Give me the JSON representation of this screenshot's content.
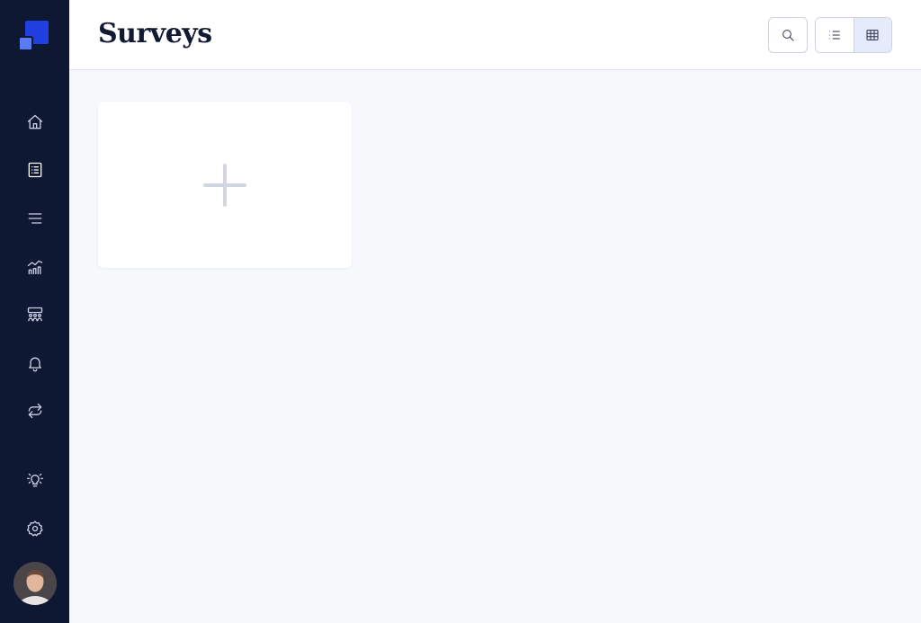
{
  "app": {
    "logo_icon": "brand-logo-icon"
  },
  "sidebar": {
    "items": [
      {
        "name": "home",
        "icon": "home-icon",
        "active": false
      },
      {
        "name": "surveys",
        "icon": "clipboard-list-icon",
        "active": true
      },
      {
        "name": "menu",
        "icon": "lines-icon",
        "active": false
      },
      {
        "name": "analytics",
        "icon": "chart-icon",
        "active": false
      },
      {
        "name": "audiences",
        "icon": "people-icon",
        "active": false
      },
      {
        "name": "notifications",
        "icon": "bell-icon",
        "active": false
      },
      {
        "name": "integrations",
        "icon": "repeat-icon",
        "active": false
      }
    ],
    "bottom_items": [
      {
        "name": "ideas",
        "icon": "lightbulb-icon"
      },
      {
        "name": "settings",
        "icon": "gear-icon"
      }
    ],
    "avatar_icon": "user-avatar"
  },
  "header": {
    "title": "Surveys",
    "search_icon": "search-icon",
    "view_modes": [
      {
        "name": "list",
        "icon": "list-icon",
        "selected": false
      },
      {
        "name": "grid",
        "icon": "grid-icon",
        "selected": true
      }
    ]
  },
  "main": {
    "add_card_icon": "plus-icon"
  },
  "colors": {
    "sidebar_bg": "#0f1833",
    "accent": "#1f3fe0",
    "content_bg": "#f7f8fc",
    "selected_toggle": "#e6ebfb"
  }
}
